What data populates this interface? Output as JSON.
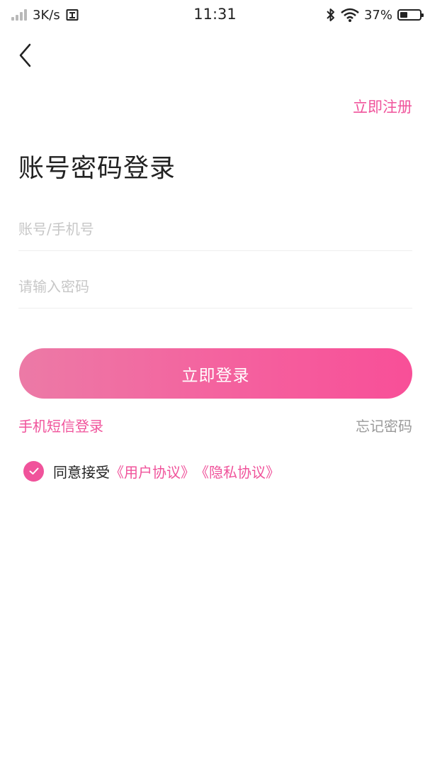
{
  "status_bar": {
    "network_speed": "3K/s",
    "time": "11:31",
    "battery_percent": "37%",
    "battery_level": 0.37
  },
  "nav": {
    "back_icon": "chevron-left-icon",
    "register_label": "立即注册"
  },
  "title": "账号密码登录",
  "form": {
    "account_placeholder": "账号/手机号",
    "account_value": "",
    "password_placeholder": "请输入密码",
    "password_value": "",
    "login_label": "立即登录"
  },
  "links": {
    "sms_login": "手机短信登录",
    "forgot_password": "忘记密码"
  },
  "agreement": {
    "checked": true,
    "prefix": "同意接受",
    "user_agreement": "《用户协议》",
    "privacy_policy": "《隐私协议》"
  },
  "colors": {
    "accent": "#f0539b",
    "button_gradient_start": "#ec7aa6",
    "button_gradient_end": "#f84f98",
    "placeholder": "#c7c7c7",
    "secondary_text": "#9a9a9a"
  }
}
